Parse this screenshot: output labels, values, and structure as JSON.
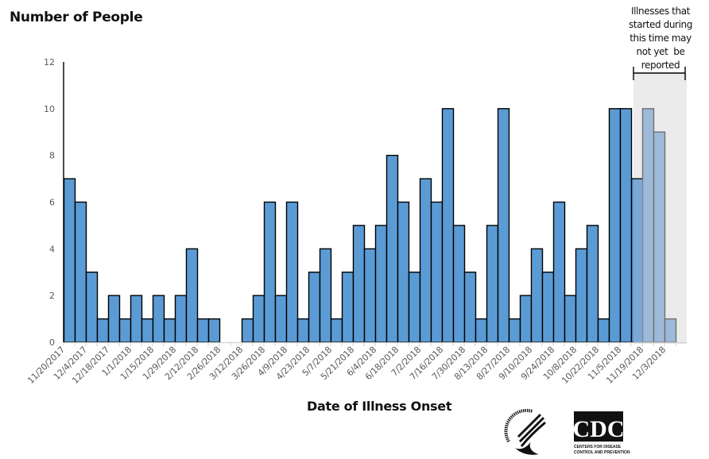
{
  "chart_data": {
    "type": "bar",
    "title": "",
    "ylabel": "Number of People",
    "xlabel": "Date of Illness Onset",
    "ylim": [
      0,
      12
    ],
    "yticks": [
      0,
      2,
      4,
      6,
      8,
      10,
      12
    ],
    "grid": false,
    "bin": "weekly",
    "start_date": "11/20/2017",
    "tick_labels": [
      "11/20/2017",
      "12/4/2017",
      "12/18/2017",
      "1/1/2018",
      "1/15/2018",
      "1/29/2018",
      "2/12/2018",
      "2/26/2018",
      "3/12/2018",
      "3/26/2018",
      "4/9/2018",
      "4/23/2018",
      "5/7/2018",
      "5/21/2018",
      "6/4/2018",
      "6/18/2018",
      "7/2/2018",
      "7/16/2018",
      "7/30/2018",
      "8/13/2018",
      "8/27/2018",
      "9/10/2018",
      "9/24/2018",
      "10/8/2018",
      "10/22/2018",
      "11/5/2018",
      "11/19/2018",
      "12/3/2018"
    ],
    "values": [
      7,
      6,
      3,
      1,
      2,
      1,
      2,
      1,
      2,
      1,
      2,
      4,
      1,
      1,
      0,
      0,
      1,
      2,
      6,
      2,
      6,
      1,
      3,
      4,
      1,
      3,
      5,
      4,
      5,
      8,
      6,
      3,
      7,
      6,
      10,
      5,
      3,
      1,
      5,
      10,
      1,
      2,
      4,
      3,
      6,
      2,
      4,
      5,
      1,
      10,
      10,
      7,
      10,
      9,
      1
    ],
    "pending_from_index": 52,
    "annotation": {
      "lines": [
        "Illnesses that",
        "started during",
        "this time may",
        "not yet  be",
        "reported"
      ]
    },
    "colors": {
      "bar": "#5b9bd5",
      "bar_pending": "#9dbad8",
      "pending_region": "#ebebeb",
      "bar_stroke": "#000000",
      "bar_pending_stroke": "#707070"
    }
  },
  "logos": {
    "hhs": "DEPARTMENT OF HEALTH & HUMAN SERVICES USA",
    "cdc": "CDC",
    "cdc_sub1": "CENTERS FOR DISEASE",
    "cdc_sub2": "CONTROL AND PREVENTION"
  }
}
